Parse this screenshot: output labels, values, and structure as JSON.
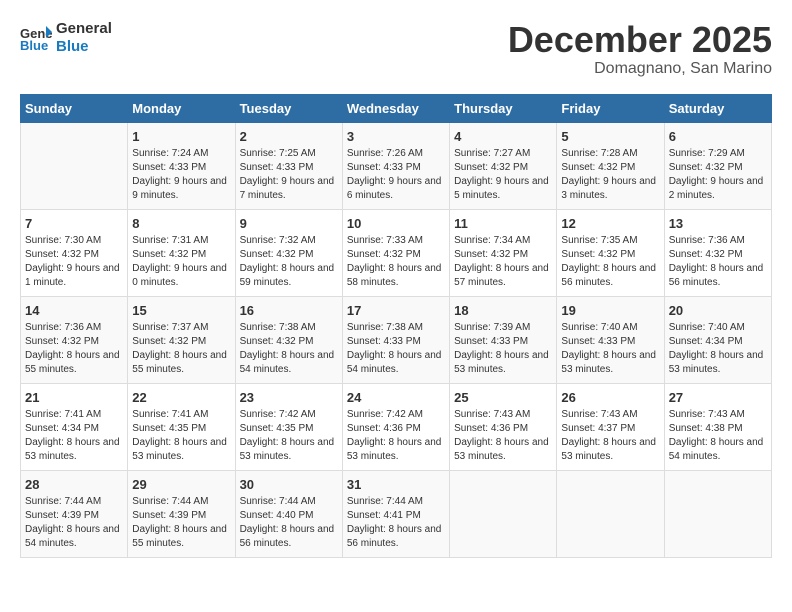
{
  "header": {
    "logo_line1": "General",
    "logo_line2": "Blue",
    "month": "December 2025",
    "location": "Domagnano, San Marino"
  },
  "weekdays": [
    "Sunday",
    "Monday",
    "Tuesday",
    "Wednesday",
    "Thursday",
    "Friday",
    "Saturday"
  ],
  "weeks": [
    [
      {
        "day": "",
        "sunrise": "",
        "sunset": "",
        "daylight": ""
      },
      {
        "day": "1",
        "sunrise": "Sunrise: 7:24 AM",
        "sunset": "Sunset: 4:33 PM",
        "daylight": "Daylight: 9 hours and 9 minutes."
      },
      {
        "day": "2",
        "sunrise": "Sunrise: 7:25 AM",
        "sunset": "Sunset: 4:33 PM",
        "daylight": "Daylight: 9 hours and 7 minutes."
      },
      {
        "day": "3",
        "sunrise": "Sunrise: 7:26 AM",
        "sunset": "Sunset: 4:33 PM",
        "daylight": "Daylight: 9 hours and 6 minutes."
      },
      {
        "day": "4",
        "sunrise": "Sunrise: 7:27 AM",
        "sunset": "Sunset: 4:32 PM",
        "daylight": "Daylight: 9 hours and 5 minutes."
      },
      {
        "day": "5",
        "sunrise": "Sunrise: 7:28 AM",
        "sunset": "Sunset: 4:32 PM",
        "daylight": "Daylight: 9 hours and 3 minutes."
      },
      {
        "day": "6",
        "sunrise": "Sunrise: 7:29 AM",
        "sunset": "Sunset: 4:32 PM",
        "daylight": "Daylight: 9 hours and 2 minutes."
      }
    ],
    [
      {
        "day": "7",
        "sunrise": "Sunrise: 7:30 AM",
        "sunset": "Sunset: 4:32 PM",
        "daylight": "Daylight: 9 hours and 1 minute."
      },
      {
        "day": "8",
        "sunrise": "Sunrise: 7:31 AM",
        "sunset": "Sunset: 4:32 PM",
        "daylight": "Daylight: 9 hours and 0 minutes."
      },
      {
        "day": "9",
        "sunrise": "Sunrise: 7:32 AM",
        "sunset": "Sunset: 4:32 PM",
        "daylight": "Daylight: 8 hours and 59 minutes."
      },
      {
        "day": "10",
        "sunrise": "Sunrise: 7:33 AM",
        "sunset": "Sunset: 4:32 PM",
        "daylight": "Daylight: 8 hours and 58 minutes."
      },
      {
        "day": "11",
        "sunrise": "Sunrise: 7:34 AM",
        "sunset": "Sunset: 4:32 PM",
        "daylight": "Daylight: 8 hours and 57 minutes."
      },
      {
        "day": "12",
        "sunrise": "Sunrise: 7:35 AM",
        "sunset": "Sunset: 4:32 PM",
        "daylight": "Daylight: 8 hours and 56 minutes."
      },
      {
        "day": "13",
        "sunrise": "Sunrise: 7:36 AM",
        "sunset": "Sunset: 4:32 PM",
        "daylight": "Daylight: 8 hours and 56 minutes."
      }
    ],
    [
      {
        "day": "14",
        "sunrise": "Sunrise: 7:36 AM",
        "sunset": "Sunset: 4:32 PM",
        "daylight": "Daylight: 8 hours and 55 minutes."
      },
      {
        "day": "15",
        "sunrise": "Sunrise: 7:37 AM",
        "sunset": "Sunset: 4:32 PM",
        "daylight": "Daylight: 8 hours and 55 minutes."
      },
      {
        "day": "16",
        "sunrise": "Sunrise: 7:38 AM",
        "sunset": "Sunset: 4:32 PM",
        "daylight": "Daylight: 8 hours and 54 minutes."
      },
      {
        "day": "17",
        "sunrise": "Sunrise: 7:38 AM",
        "sunset": "Sunset: 4:33 PM",
        "daylight": "Daylight: 8 hours and 54 minutes."
      },
      {
        "day": "18",
        "sunrise": "Sunrise: 7:39 AM",
        "sunset": "Sunset: 4:33 PM",
        "daylight": "Daylight: 8 hours and 53 minutes."
      },
      {
        "day": "19",
        "sunrise": "Sunrise: 7:40 AM",
        "sunset": "Sunset: 4:33 PM",
        "daylight": "Daylight: 8 hours and 53 minutes."
      },
      {
        "day": "20",
        "sunrise": "Sunrise: 7:40 AM",
        "sunset": "Sunset: 4:34 PM",
        "daylight": "Daylight: 8 hours and 53 minutes."
      }
    ],
    [
      {
        "day": "21",
        "sunrise": "Sunrise: 7:41 AM",
        "sunset": "Sunset: 4:34 PM",
        "daylight": "Daylight: 8 hours and 53 minutes."
      },
      {
        "day": "22",
        "sunrise": "Sunrise: 7:41 AM",
        "sunset": "Sunset: 4:35 PM",
        "daylight": "Daylight: 8 hours and 53 minutes."
      },
      {
        "day": "23",
        "sunrise": "Sunrise: 7:42 AM",
        "sunset": "Sunset: 4:35 PM",
        "daylight": "Daylight: 8 hours and 53 minutes."
      },
      {
        "day": "24",
        "sunrise": "Sunrise: 7:42 AM",
        "sunset": "Sunset: 4:36 PM",
        "daylight": "Daylight: 8 hours and 53 minutes."
      },
      {
        "day": "25",
        "sunrise": "Sunrise: 7:43 AM",
        "sunset": "Sunset: 4:36 PM",
        "daylight": "Daylight: 8 hours and 53 minutes."
      },
      {
        "day": "26",
        "sunrise": "Sunrise: 7:43 AM",
        "sunset": "Sunset: 4:37 PM",
        "daylight": "Daylight: 8 hours and 53 minutes."
      },
      {
        "day": "27",
        "sunrise": "Sunrise: 7:43 AM",
        "sunset": "Sunset: 4:38 PM",
        "daylight": "Daylight: 8 hours and 54 minutes."
      }
    ],
    [
      {
        "day": "28",
        "sunrise": "Sunrise: 7:44 AM",
        "sunset": "Sunset: 4:39 PM",
        "daylight": "Daylight: 8 hours and 54 minutes."
      },
      {
        "day": "29",
        "sunrise": "Sunrise: 7:44 AM",
        "sunset": "Sunset: 4:39 PM",
        "daylight": "Daylight: 8 hours and 55 minutes."
      },
      {
        "day": "30",
        "sunrise": "Sunrise: 7:44 AM",
        "sunset": "Sunset: 4:40 PM",
        "daylight": "Daylight: 8 hours and 56 minutes."
      },
      {
        "day": "31",
        "sunrise": "Sunrise: 7:44 AM",
        "sunset": "Sunset: 4:41 PM",
        "daylight": "Daylight: 8 hours and 56 minutes."
      },
      {
        "day": "",
        "sunrise": "",
        "sunset": "",
        "daylight": ""
      },
      {
        "day": "",
        "sunrise": "",
        "sunset": "",
        "daylight": ""
      },
      {
        "day": "",
        "sunrise": "",
        "sunset": "",
        "daylight": ""
      }
    ]
  ]
}
